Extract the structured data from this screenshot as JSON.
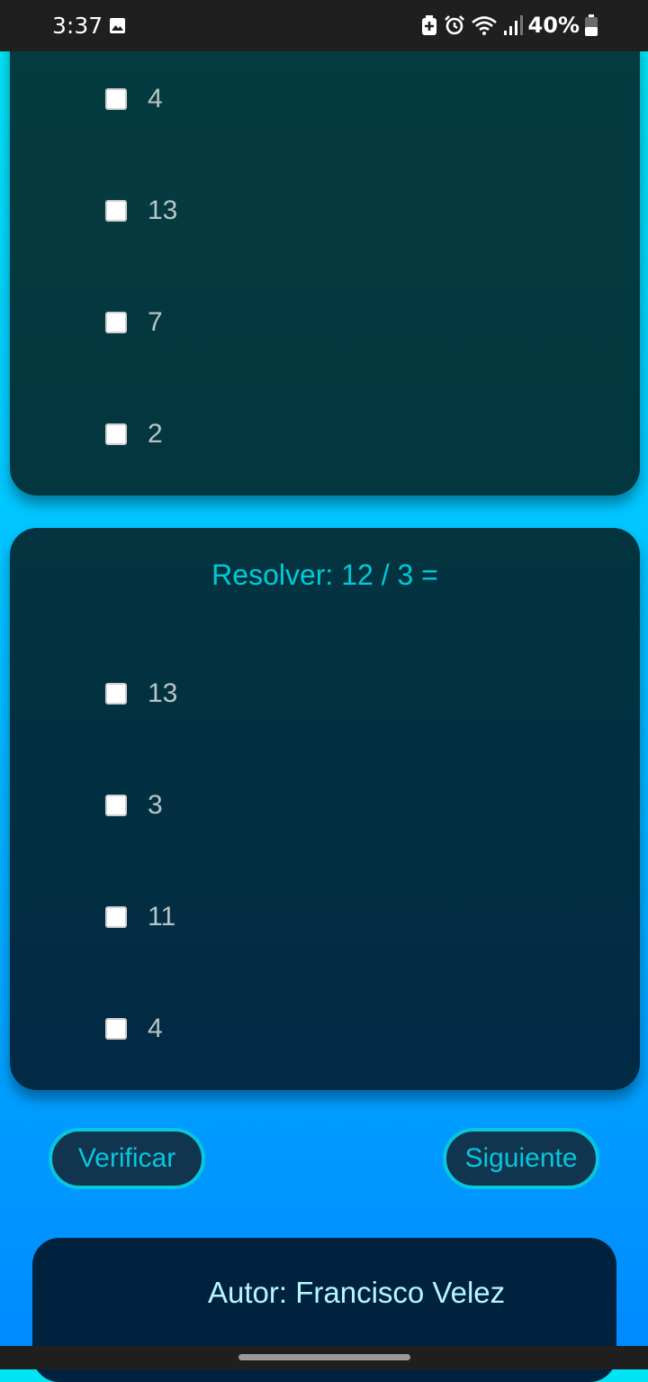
{
  "status_bar": {
    "time": "3:37",
    "battery": "40%"
  },
  "question_1": {
    "options": [
      {
        "label": "4",
        "checked": false
      },
      {
        "label": "13",
        "checked": false
      },
      {
        "label": "7",
        "checked": false
      },
      {
        "label": "2",
        "checked": false
      }
    ]
  },
  "question_2": {
    "title": "Resolver: 12 / 3 =",
    "options": [
      {
        "label": "13",
        "checked": false
      },
      {
        "label": "3",
        "checked": false
      },
      {
        "label": "11",
        "checked": false
      },
      {
        "label": "4",
        "checked": false
      }
    ]
  },
  "actions": {
    "verify_label": "Verificar",
    "next_label": "Siguiente"
  },
  "footer": {
    "author": "Autor: Francisco Velez"
  },
  "colors": {
    "accent": "#06c7dc",
    "card_dark": "#012a44",
    "button_bg": "#11344f"
  }
}
